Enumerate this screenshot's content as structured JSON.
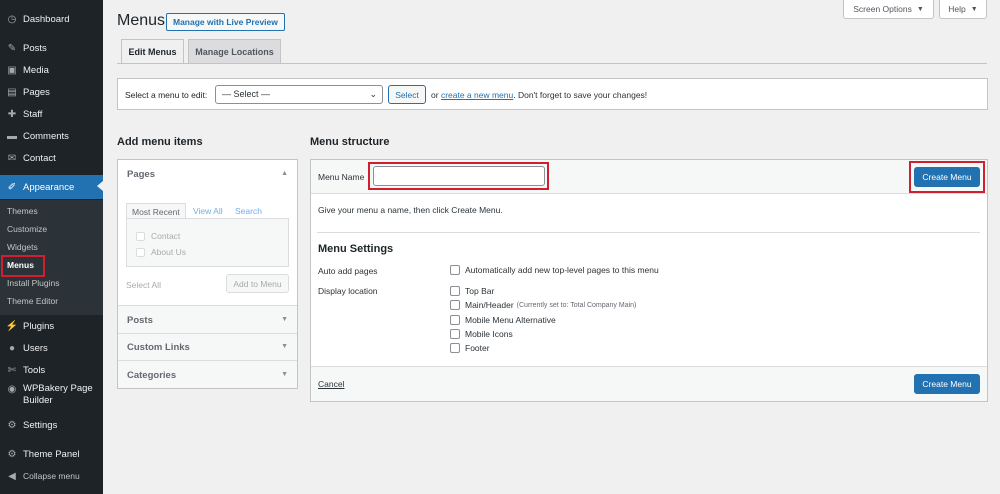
{
  "sidebar": {
    "items": [
      {
        "label": "Dashboard",
        "icon": "dashboard-icon",
        "glyph": "◷"
      },
      {
        "label": "Posts",
        "icon": "pin-icon",
        "glyph": "✎"
      },
      {
        "label": "Media",
        "icon": "media-icon",
        "glyph": "▣"
      },
      {
        "label": "Pages",
        "icon": "page-icon",
        "glyph": "▤"
      },
      {
        "label": "Staff",
        "icon": "wrench-icon",
        "glyph": "✚"
      },
      {
        "label": "Comments",
        "icon": "comment-icon",
        "glyph": "▬"
      },
      {
        "label": "Contact",
        "icon": "mail-icon",
        "glyph": "✉"
      },
      {
        "label": "Appearance",
        "icon": "brush-icon",
        "glyph": "✐"
      },
      {
        "label": "Plugins",
        "icon": "plugin-icon",
        "glyph": "⚡"
      },
      {
        "label": "Users",
        "icon": "users-icon",
        "glyph": "●"
      },
      {
        "label": "Tools",
        "icon": "tools-icon",
        "glyph": "✄"
      },
      {
        "label": "WPBakery Page Builder",
        "icon": "wpbakery-icon",
        "glyph": "◉"
      },
      {
        "label": "Settings",
        "icon": "settings-icon",
        "glyph": "⚙"
      },
      {
        "label": "Theme Panel",
        "icon": "gear-icon",
        "glyph": "⚙"
      },
      {
        "label": "Collapse menu",
        "icon": "collapse-icon",
        "glyph": "◀"
      }
    ],
    "submenu": [
      "Themes",
      "Customize",
      "Widgets",
      "Menus",
      "Install Plugins",
      "Theme Editor"
    ]
  },
  "header": {
    "screen_options": "Screen Options",
    "help": "Help",
    "title": "Menus",
    "live_preview": "Manage with Live Preview",
    "tabs": [
      "Edit Menus",
      "Manage Locations"
    ]
  },
  "select_bar": {
    "label": "Select a menu to edit:",
    "selected": "— Select —",
    "select_button": "Select",
    "or": "or",
    "create_link": "create a new menu",
    "note": ". Don't forget to save your changes!"
  },
  "add_items": {
    "title": "Add menu items",
    "sections": [
      "Pages",
      "Posts",
      "Custom Links",
      "Categories"
    ],
    "inner_tabs": [
      "Most Recent",
      "View All",
      "Search"
    ],
    "pages": [
      "Contact",
      "About Us"
    ],
    "select_all": "Select All",
    "add_button": "Add to Menu"
  },
  "menu_structure": {
    "title": "Menu structure",
    "name_label": "Menu Name",
    "name_value": "",
    "create_button": "Create Menu",
    "hint": "Give your menu a name, then click Create Menu.",
    "settings_title": "Menu Settings",
    "auto_add_label": "Auto add pages",
    "auto_add_option": "Automatically add new top-level pages to this menu",
    "display_label": "Display location",
    "locations": [
      {
        "name": "Top Bar",
        "note": ""
      },
      {
        "name": "Main/Header",
        "note": "(Currently set to: Total Company Main)"
      },
      {
        "name": "Mobile Menu Alternative",
        "note": ""
      },
      {
        "name": "Mobile Icons",
        "note": ""
      },
      {
        "name": "Footer",
        "note": ""
      }
    ],
    "cancel": "Cancel"
  },
  "colors": {
    "accent": "#2271b1",
    "sidebar": "#1d2327",
    "highlight": "#d01f2e"
  }
}
